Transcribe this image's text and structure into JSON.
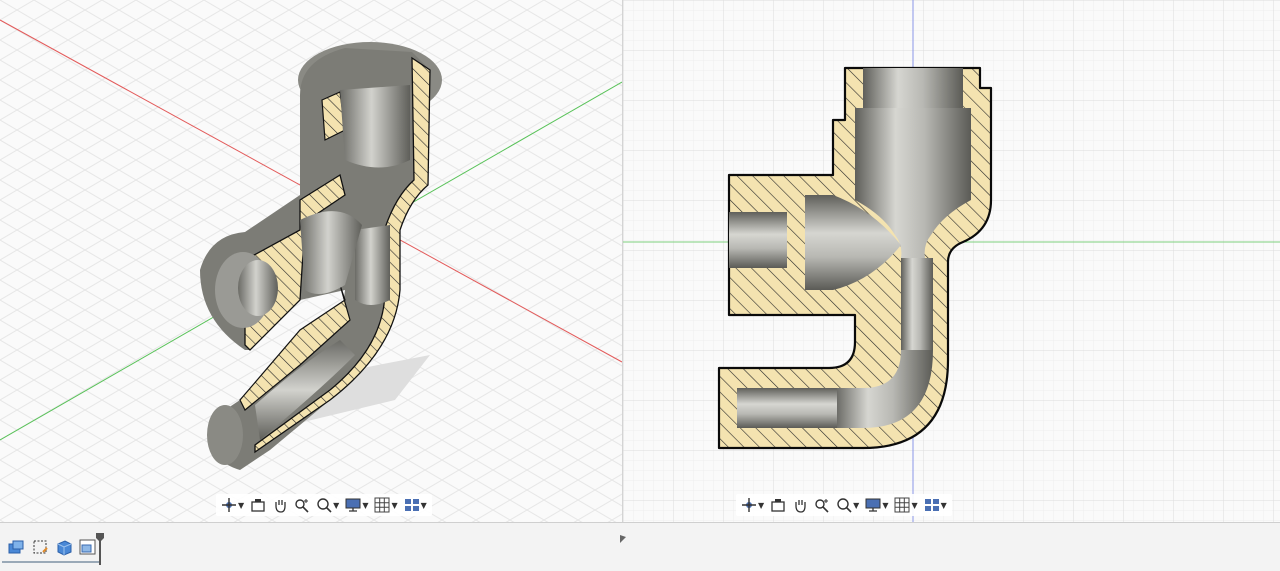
{
  "viewports": [
    {
      "id": "left",
      "view": "isometric",
      "model": "pipe-fitting-section"
    },
    {
      "id": "right",
      "view": "front",
      "model": "pipe-fitting-section"
    }
  ],
  "nav_toolbar": {
    "tools": [
      {
        "icon": "orbit-icon",
        "has_menu": true
      },
      {
        "icon": "look-at-icon",
        "has_menu": false
      },
      {
        "icon": "pan-hand-icon",
        "has_menu": false
      },
      {
        "icon": "zoom-icon",
        "has_menu": false
      },
      {
        "icon": "fit-zoom-icon",
        "has_menu": true
      },
      {
        "icon": "display-settings-icon",
        "has_menu": true
      },
      {
        "icon": "grid-settings-icon",
        "has_menu": true
      },
      {
        "icon": "viewports-icon",
        "has_menu": true
      }
    ]
  },
  "timeline": {
    "features": [
      {
        "icon": "sketch-feature-icon"
      },
      {
        "icon": "plane-feature-icon"
      },
      {
        "icon": "extrude-feature-icon"
      },
      {
        "icon": "section-feature-icon"
      }
    ]
  },
  "colors": {
    "viewport_bg": "#fafafa",
    "grid_minor": "#ececec",
    "grid_major": "#dcdcdc",
    "section_fill": "#f4e3b0",
    "hatch": "#2a2a2a",
    "metal_dark": "#6e6e69",
    "metal_light": "#cfcfca",
    "axis_x": "#e35b5b",
    "axis_y": "#58c258",
    "axis_z": "#6b7de0"
  }
}
